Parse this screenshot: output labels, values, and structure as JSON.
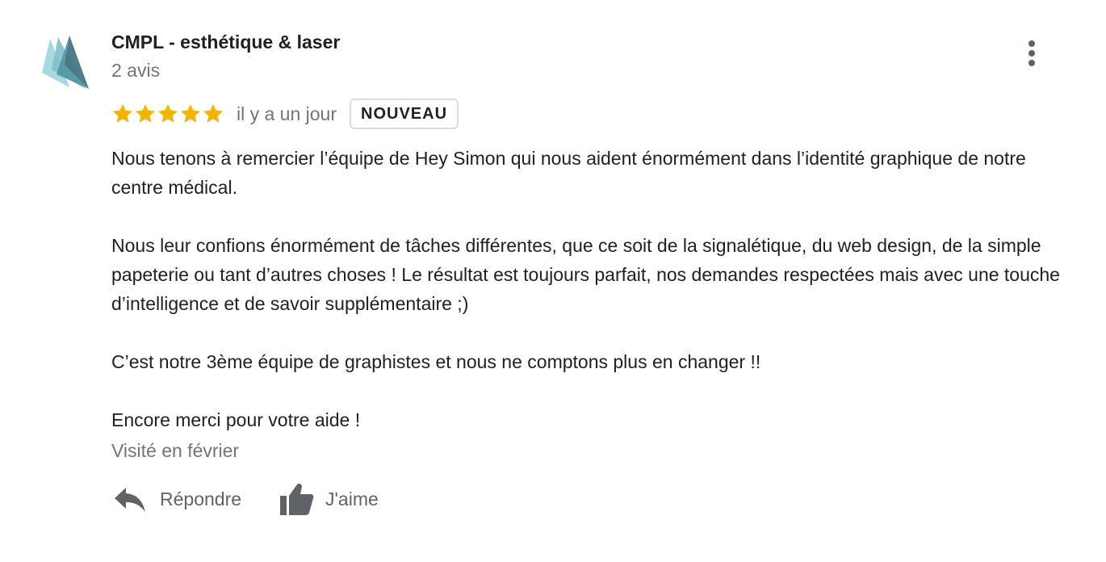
{
  "review": {
    "author": {
      "name": "CMPL - esthétique & laser",
      "meta": "2 avis"
    },
    "rating": {
      "stars": 5,
      "max": 5,
      "star_color": "#f4b400"
    },
    "time": "il y a un jour",
    "badge": "NOUVEAU",
    "paragraphs": [
      "Nous tenons à remercier l’équipe de Hey Simon qui nous aident énormément dans l’identité graphique de notre centre médical.",
      "Nous leur confions énormément de tâches différentes, que ce soit de la signalétique, du web design, de la simple papeterie ou tant d’autres choses ! Le résultat est toujours parfait, nos demandes respectées mais avec une touche d’intelligence et de savoir supplémentaire ;)",
      "C’est notre 3ème équipe de graphistes et nous ne comptons plus en changer !!",
      "Encore merci pour votre aide !"
    ],
    "visited": "Visité en février",
    "actions": {
      "reply_label": "Répondre",
      "like_label": "J'aime"
    }
  },
  "icons": {
    "avatar": "triangle-logo",
    "more": "more-vert-icon",
    "reply": "reply-icon",
    "like": "thumb-up-icon"
  },
  "colors": {
    "text_primary": "#202124",
    "text_secondary": "#70757a",
    "icon_grey": "#5f6368",
    "avatar_teal": "#5ba3b4",
    "avatar_light": "#9fd3de"
  }
}
